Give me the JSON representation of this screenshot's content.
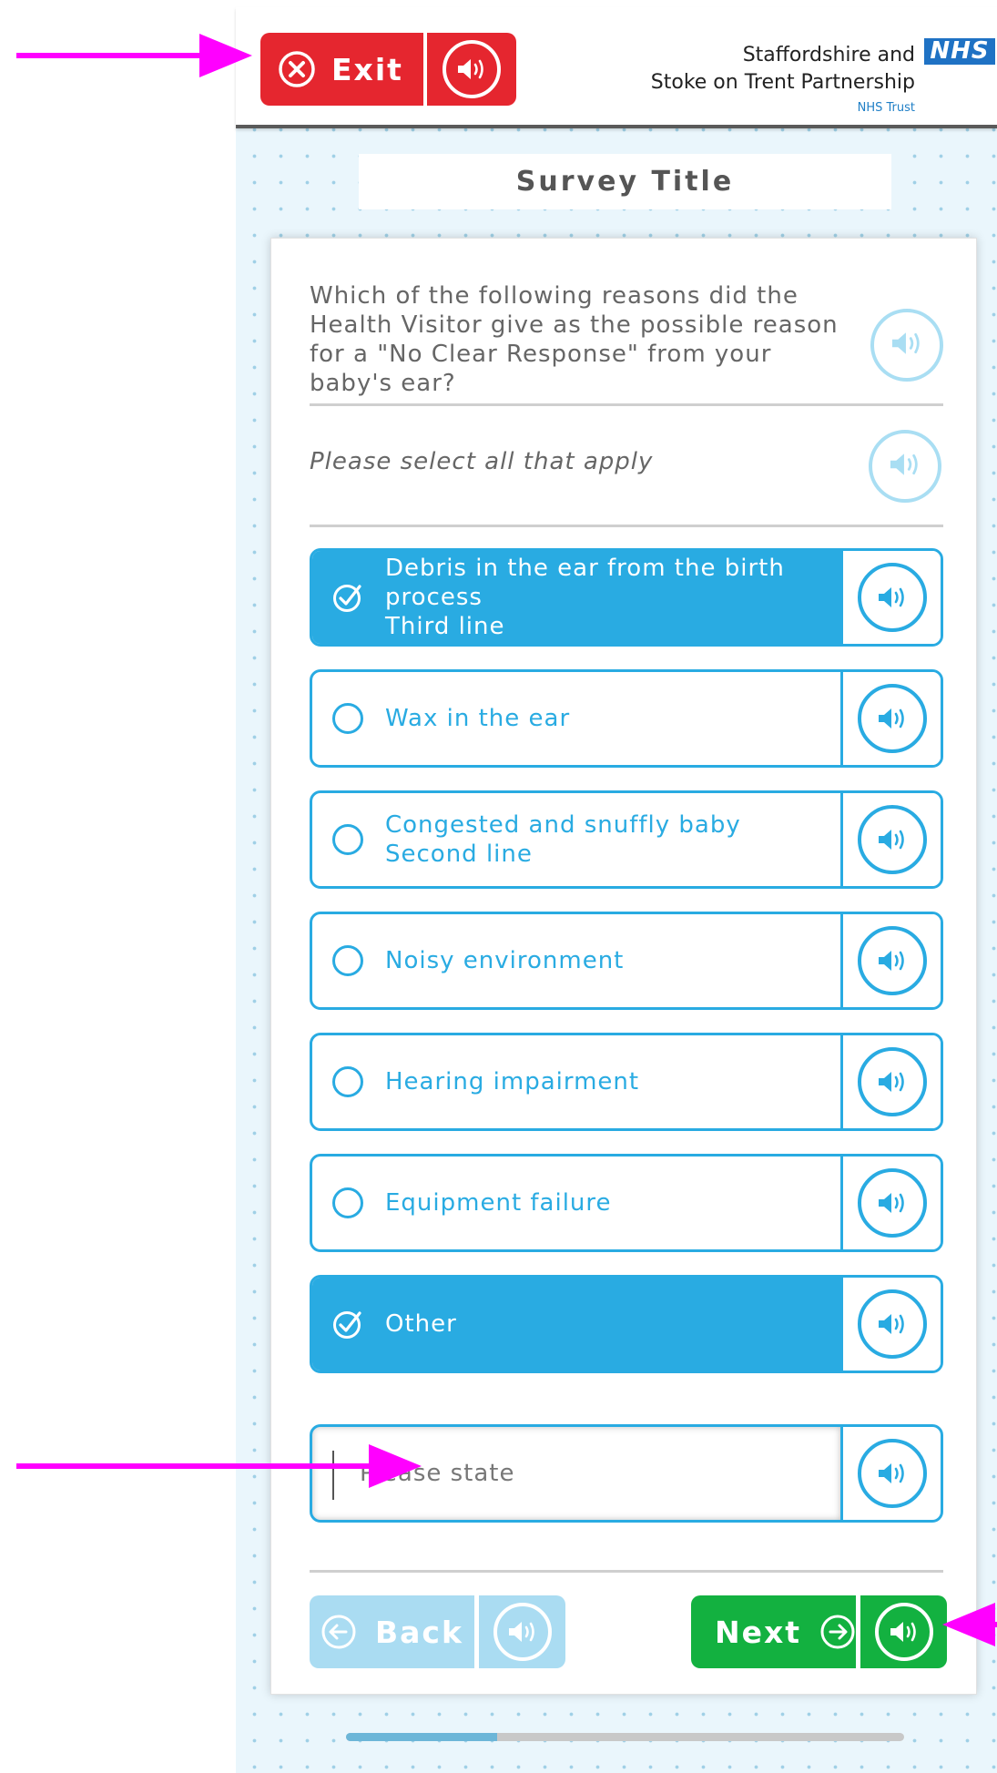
{
  "header": {
    "exit_label": "Exit",
    "brand_line1": "Staffordshire and",
    "brand_line2": "Stoke on Trent Partnership",
    "brand_line3": "NHS Trust",
    "logo_text": "NHS"
  },
  "survey_title": "Survey Title",
  "question": {
    "text": "Which of the following reasons did the Health Visitor give as the possible reason for a \"No Clear Response\" from your baby's ear?",
    "instruction": "Please select all that apply"
  },
  "options": [
    {
      "label": "Debris in the ear from the birth\nprocess\nThird line",
      "selected": true
    },
    {
      "label": "Wax in the ear",
      "selected": false
    },
    {
      "label": "Congested and snuffly baby\nSecond line",
      "selected": false
    },
    {
      "label": "Noisy environment",
      "selected": false
    },
    {
      "label": "Hearing impairment",
      "selected": false
    },
    {
      "label": "Equipment failure",
      "selected": false
    },
    {
      "label": "Other",
      "selected": true
    }
  ],
  "other_input": {
    "placeholder": "Please state",
    "value": ""
  },
  "navigation": {
    "back_label": "Back",
    "next_label": "Next"
  },
  "progress": {
    "fraction": 0.27
  },
  "colors": {
    "exit_red": "#e5262f",
    "option_blue": "#29abe2",
    "next_green": "#13b140",
    "back_disabled": "#aadcf2",
    "annotation_magenta": "#ff00ff",
    "nhs_blue": "#1f72c4"
  },
  "icons": {
    "exit": "close-circle-icon",
    "audio": "speaker-icon",
    "checked": "check-circle-icon",
    "back": "arrow-left-circle-icon",
    "next": "arrow-right-circle-icon"
  }
}
